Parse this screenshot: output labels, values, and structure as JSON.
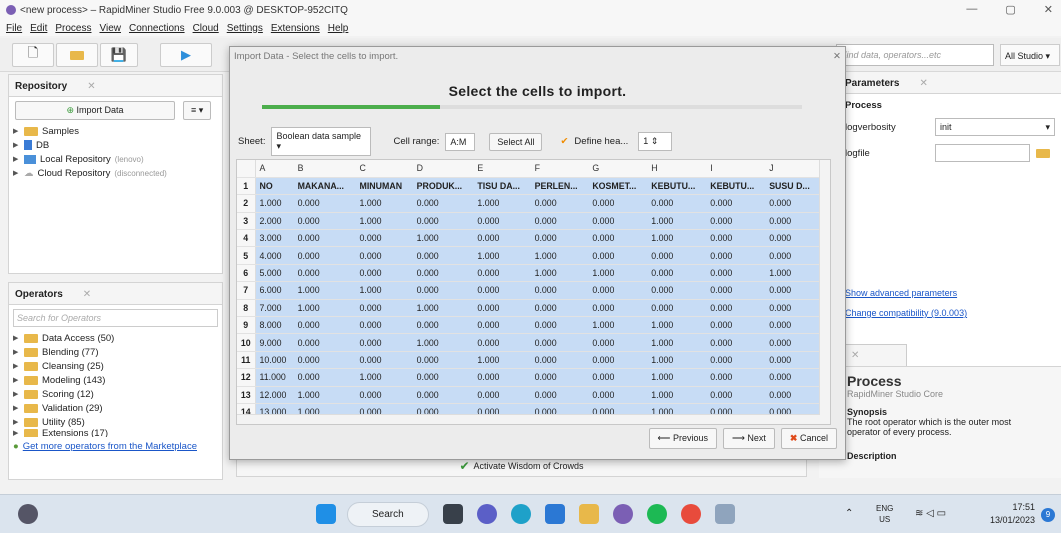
{
  "window": {
    "title": "<new process> – RapidMiner Studio Free 9.0.003 @ DESKTOP-952CITQ"
  },
  "menu": [
    "File",
    "Edit",
    "Process",
    "View",
    "Connections",
    "Cloud",
    "Settings",
    "Extensions",
    "Help"
  ],
  "toolbar": {
    "search_placeholder": "Find data, operators...etc",
    "perspective": "All Studio"
  },
  "repository": {
    "tab": "Repository",
    "import_label": "Import Data",
    "items": [
      {
        "label": "Samples",
        "note": ""
      },
      {
        "label": "DB",
        "note": ""
      },
      {
        "label": "Local Repository",
        "note": "(lenovo)"
      },
      {
        "label": "Cloud Repository",
        "note": "(disconnected)"
      }
    ]
  },
  "operators": {
    "tab": "Operators",
    "search_placeholder": "Search for Operators",
    "items": [
      "Data Access (50)",
      "Blending (77)",
      "Cleansing (25)",
      "Modeling (143)",
      "Scoring (12)",
      "Validation (29)",
      "Utility (85)",
      "Extensions (17)"
    ],
    "marketplace_link": "Get more operators from the Marketplace"
  },
  "dialog": {
    "title": "Import Data - Select the cells to import.",
    "heading": "Select the cells to import.",
    "progress": 0.33,
    "sheet_label": "Sheet:",
    "sheet_value": "Boolean data sample",
    "cellrange_label": "Cell range:",
    "cellrange_value": "A:M",
    "select_all": "Select All",
    "define_header": "Define hea...",
    "header_row": "1",
    "columns": [
      "A",
      "B",
      "C",
      "D",
      "E",
      "F",
      "G",
      "H",
      "I",
      "J"
    ],
    "rows": [
      [
        "NO",
        "MAKANA...",
        "MINUMAN",
        "PRODUK...",
        "TISU DA...",
        "PERLEN...",
        "KOSMET...",
        "KEBUTU...",
        "KEBUTU...",
        "SUSU D..."
      ],
      [
        "1.000",
        "0.000",
        "1.000",
        "0.000",
        "1.000",
        "0.000",
        "0.000",
        "0.000",
        "0.000",
        "0.000"
      ],
      [
        "2.000",
        "0.000",
        "1.000",
        "0.000",
        "0.000",
        "0.000",
        "0.000",
        "1.000",
        "0.000",
        "0.000"
      ],
      [
        "3.000",
        "0.000",
        "0.000",
        "1.000",
        "0.000",
        "0.000",
        "0.000",
        "1.000",
        "0.000",
        "0.000"
      ],
      [
        "4.000",
        "0.000",
        "0.000",
        "0.000",
        "1.000",
        "1.000",
        "0.000",
        "0.000",
        "0.000",
        "0.000"
      ],
      [
        "5.000",
        "0.000",
        "0.000",
        "0.000",
        "0.000",
        "1.000",
        "1.000",
        "0.000",
        "0.000",
        "1.000"
      ],
      [
        "6.000",
        "1.000",
        "1.000",
        "0.000",
        "0.000",
        "0.000",
        "0.000",
        "0.000",
        "0.000",
        "0.000"
      ],
      [
        "7.000",
        "1.000",
        "0.000",
        "1.000",
        "0.000",
        "0.000",
        "0.000",
        "0.000",
        "0.000",
        "0.000"
      ],
      [
        "8.000",
        "0.000",
        "0.000",
        "0.000",
        "0.000",
        "0.000",
        "1.000",
        "1.000",
        "0.000",
        "0.000"
      ],
      [
        "9.000",
        "0.000",
        "0.000",
        "1.000",
        "0.000",
        "0.000",
        "0.000",
        "1.000",
        "0.000",
        "0.000"
      ],
      [
        "10.000",
        "0.000",
        "0.000",
        "0.000",
        "1.000",
        "0.000",
        "0.000",
        "1.000",
        "0.000",
        "0.000"
      ],
      [
        "11.000",
        "0.000",
        "1.000",
        "0.000",
        "0.000",
        "0.000",
        "0.000",
        "1.000",
        "0.000",
        "0.000"
      ],
      [
        "12.000",
        "1.000",
        "0.000",
        "0.000",
        "0.000",
        "0.000",
        "0.000",
        "1.000",
        "0.000",
        "0.000"
      ],
      [
        "13.000",
        "1.000",
        "0.000",
        "0.000",
        "0.000",
        "0.000",
        "0.000",
        "1.000",
        "0.000",
        "0.000"
      ]
    ],
    "previous": "Previous",
    "next": "Next",
    "cancel": "Cancel"
  },
  "params": {
    "tab": "Parameters",
    "section": "Process",
    "verbosity_label": "logverbosity",
    "verbosity_value": "init",
    "file_label": "logfile",
    "show_advanced": "Show advanced parameters",
    "change_compat": "Change compatibility (9.0.003)"
  },
  "help": {
    "title": "Process",
    "subtitle": "RapidMiner Studio Core",
    "synopsis_label": "Synopsis",
    "synopsis": "The root operator which is the outer most operator of every process.",
    "description_label": "Description"
  },
  "bottom": {
    "activate": "Activate Wisdom of Crowds"
  },
  "taskbar": {
    "search": "Search",
    "lang": "ENG",
    "region": "US",
    "time": "17:51",
    "date": "13/01/2023",
    "badge": "9"
  }
}
